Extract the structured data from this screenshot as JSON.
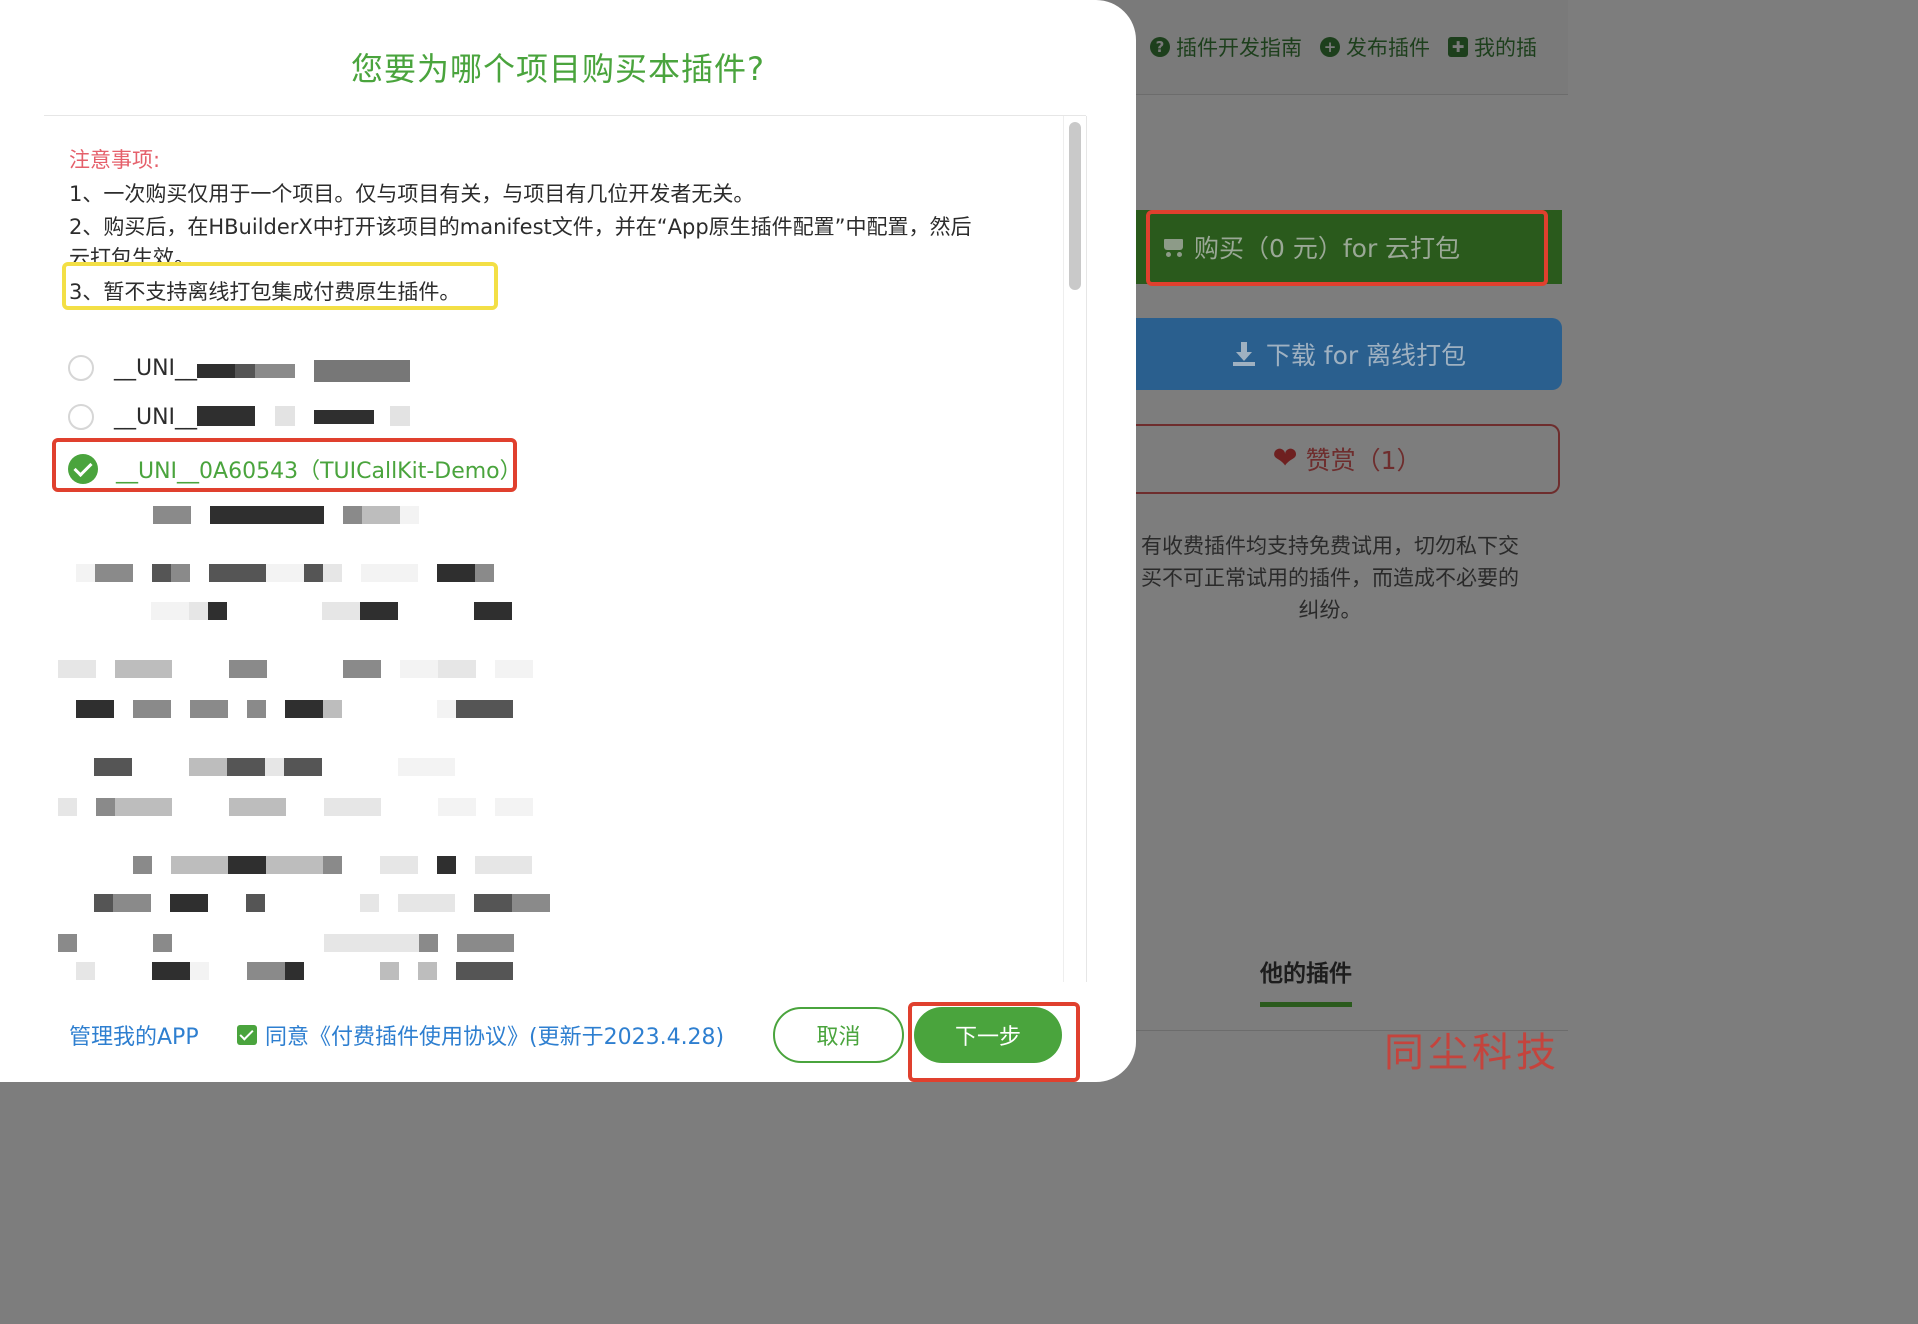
{
  "background": {
    "nav": [
      {
        "icon": "question-circle-icon",
        "glyph": "?",
        "label": "插件开发指南"
      },
      {
        "icon": "plus-circle-icon",
        "glyph": "+",
        "label": "发布插件"
      },
      {
        "icon": "puzzle-icon",
        "glyph": "✚",
        "label": "我的插"
      }
    ],
    "buy_label": "购买（0 元）for 云打包",
    "download_label": "下载 for 离线打包",
    "reward_label": "赞赏（1）",
    "notice": [
      "有收费插件均支持免费试用，切勿私下交",
      "买不可正常试用的插件，而造成不必要的",
      "纠纷。"
    ],
    "tab_label": "他的插件",
    "watermark": "同尘科技"
  },
  "modal": {
    "title": "您要为哪个项目购买本插件?",
    "notice_title": "注意事项:",
    "notice_lines": [
      "1、一次购买仅用于一个项目。仅与项目有关，与项目有几位开发者无关。",
      "2、购买后，在HBuilderX中打开该项目的manifest文件，并在“App原生插件配置”中配置，然后",
      "云打包生效。",
      "3、暂不支持离线打包集成付费原生插件。"
    ],
    "projects": [
      {
        "label": "__UNI__",
        "selected": false
      },
      {
        "label": "__UNI__",
        "selected": false
      },
      {
        "label": "__UNI__0A60543（TUICallKit-Demo）",
        "selected": true
      }
    ],
    "footer": {
      "manage_link": "管理我的APP",
      "agree_checked": true,
      "agree_text": "同意《付费插件使用协议》(更新于2023.4.28)",
      "cancel_label": "取消",
      "next_label": "下一步"
    }
  },
  "colors": {
    "accent_green": "#4aa43d",
    "link_blue": "#2e7fd0",
    "notice_red": "#e5606b",
    "highlight_red": "#e0402e",
    "highlight_yellow": "#f3df45"
  }
}
